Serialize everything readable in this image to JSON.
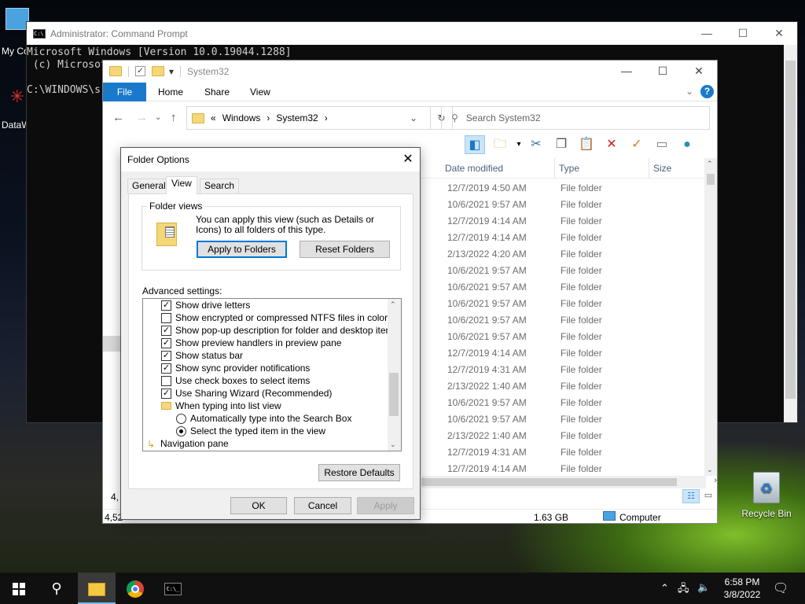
{
  "desktop": {
    "icons": [
      {
        "label": "My Co"
      },
      {
        "label": "DataW"
      },
      {
        "label": "Recycle Bin"
      }
    ]
  },
  "cmd": {
    "title": "Administrator: Command Prompt",
    "line1": "Microsoft Windows [Version 10.0.19044.1288]",
    "line2": "(c) Microsoft",
    "line3": "C:\\WINDOWS\\s"
  },
  "explorer": {
    "title": "System32",
    "ribbon": {
      "file": "File",
      "home": "Home",
      "share": "Share",
      "view": "View"
    },
    "address": {
      "prefix": "«",
      "crumbs": [
        "Windows",
        "System32"
      ]
    },
    "search_placeholder": "Search System32",
    "columns": {
      "date": "Date modified",
      "type": "Type",
      "size": "Size"
    },
    "rows": [
      {
        "date": "12/7/2019 4:50 AM",
        "type": "File folder"
      },
      {
        "date": "10/6/2021 9:57 AM",
        "type": "File folder"
      },
      {
        "date": "12/7/2019 4:14 AM",
        "type": "File folder"
      },
      {
        "date": "12/7/2019 4:14 AM",
        "type": "File folder"
      },
      {
        "date": "2/13/2022 4:20 AM",
        "type": "File folder"
      },
      {
        "date": "10/6/2021 9:57 AM",
        "type": "File folder"
      },
      {
        "date": "10/6/2021 9:57 AM",
        "type": "File folder"
      },
      {
        "date": "10/6/2021 9:57 AM",
        "type": "File folder"
      },
      {
        "date": "10/6/2021 9:57 AM",
        "type": "File folder"
      },
      {
        "date": "10/6/2021 9:57 AM",
        "type": "File folder"
      },
      {
        "date": "12/7/2019 4:14 AM",
        "type": "File folder"
      },
      {
        "date": "12/7/2019 4:31 AM",
        "type": "File folder"
      },
      {
        "date": "2/13/2022 1:40 AM",
        "type": "File folder"
      },
      {
        "date": "10/6/2021 9:57 AM",
        "type": "File folder"
      },
      {
        "date": "10/6/2021 9:57 AM",
        "type": "File folder"
      },
      {
        "date": "2/13/2022 1:40 AM",
        "type": "File folder"
      },
      {
        "date": "12/7/2019 4:31 AM",
        "type": "File folder"
      },
      {
        "date": "12/7/2019 4:14 AM",
        "type": "File folder"
      }
    ],
    "status": {
      "count_left": "4,",
      "count_left2": "4,52",
      "size": "1.63 GB",
      "location": "Computer"
    }
  },
  "dialog": {
    "title": "Folder Options",
    "tabs": [
      "General",
      "View",
      "Search"
    ],
    "folder_views": {
      "legend": "Folder views",
      "description": "You can apply this view (such as Details or Icons) to all folders of this type.",
      "apply_button": "Apply to Folders",
      "reset_button": "Reset Folders"
    },
    "advanced_label": "Advanced settings:",
    "settings": [
      {
        "label": "Show drive letters",
        "kind": "check",
        "checked": true
      },
      {
        "label": "Show encrypted or compressed NTFS files in color",
        "kind": "check",
        "checked": false
      },
      {
        "label": "Show pop-up description for folder and desktop items",
        "kind": "check",
        "checked": true
      },
      {
        "label": "Show preview handlers in preview pane",
        "kind": "check",
        "checked": true
      },
      {
        "label": "Show status bar",
        "kind": "check",
        "checked": true
      },
      {
        "label": "Show sync provider notifications",
        "kind": "check",
        "checked": true
      },
      {
        "label": "Use check boxes to select items",
        "kind": "check",
        "checked": false
      },
      {
        "label": "Use Sharing Wizard (Recommended)",
        "kind": "check",
        "checked": true
      },
      {
        "label": "When typing into list view",
        "kind": "folder"
      },
      {
        "label": "Automatically type into the Search Box",
        "kind": "radio",
        "checked": false
      },
      {
        "label": "Select the typed item in the view",
        "kind": "radio",
        "checked": true
      },
      {
        "label": "Navigation pane",
        "kind": "folder"
      }
    ],
    "restore_button": "Restore Defaults",
    "ok_button": "OK",
    "cancel_button": "Cancel",
    "apply_button": "Apply"
  },
  "taskbar": {
    "time": "6:58 PM",
    "date": "3/8/2022"
  }
}
